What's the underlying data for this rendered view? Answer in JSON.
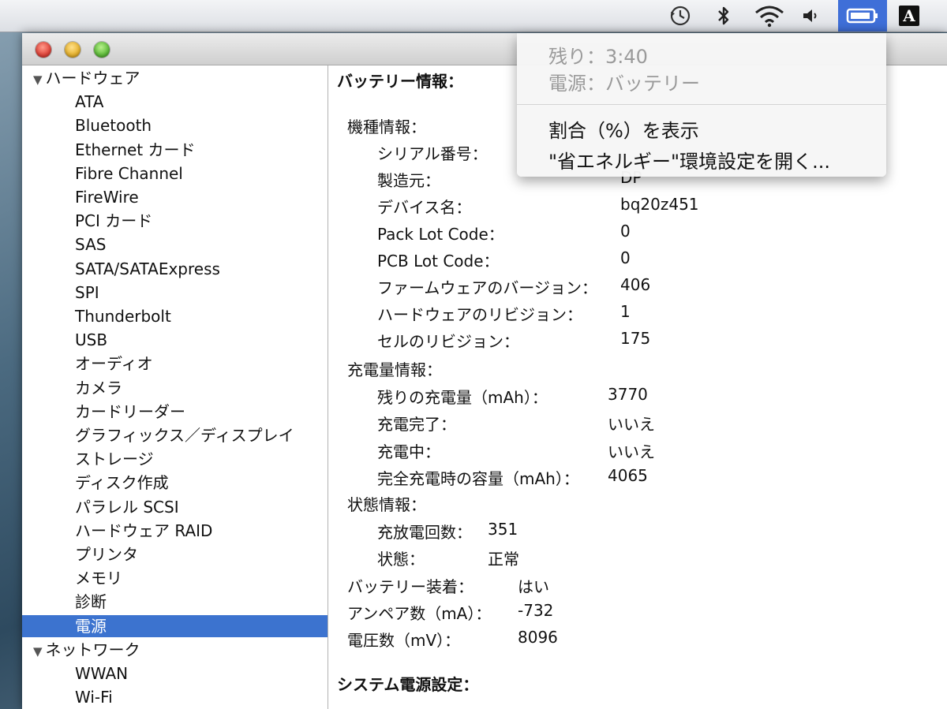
{
  "menubar": {
    "icons": [
      "time-machine-icon",
      "bluetooth-icon",
      "wifi-icon",
      "volume-icon",
      "battery-icon"
    ],
    "input_label": "A"
  },
  "sidebar": {
    "hardware_group": "ハードウェア",
    "hardware_items": [
      "ATA",
      "Bluetooth",
      "Ethernet カード",
      "Fibre Channel",
      "FireWire",
      "PCI カード",
      "SAS",
      "SATA/SATAExpress",
      "SPI",
      "Thunderbolt",
      "USB",
      "オーディオ",
      "カメラ",
      "カードリーダー",
      "グラフィックス／ディスプレイ",
      "ストレージ",
      "ディスク作成",
      "パラレル SCSI",
      "ハードウェア RAID",
      "プリンタ",
      "メモリ",
      "診断",
      "電源"
    ],
    "selected": "電源",
    "network_group": "ネットワーク",
    "network_items": [
      "WWAN",
      "Wi-Fi"
    ]
  },
  "detail": {
    "title": "バッテリー情報：",
    "model_header": "機種情報：",
    "model_rows": [
      {
        "label": "シリアル番号：",
        "value": ""
      },
      {
        "label": "製造元：",
        "value": "DP"
      },
      {
        "label": "デバイス名：",
        "value": "bq20z451"
      },
      {
        "label": "Pack Lot Code：",
        "value": "0"
      },
      {
        "label": "PCB Lot Code：",
        "value": "0"
      },
      {
        "label": "ファームウェアのバージョン：",
        "value": "406"
      },
      {
        "label": "ハードウェアのリビジョン：",
        "value": "1"
      },
      {
        "label": "セルのリビジョン：",
        "value": "175"
      }
    ],
    "charge_header": "充電量情報：",
    "charge_rows": [
      {
        "label": "残りの充電量（mAh）：",
        "value": "3770"
      },
      {
        "label": "充電完了：",
        "value": "いいえ"
      },
      {
        "label": "充電中：",
        "value": "いいえ"
      },
      {
        "label": "完全充電時の容量（mAh）：",
        "value": "4065"
      }
    ],
    "status_header": "状態情報：",
    "status_rows": [
      {
        "label": "充放電回数：",
        "value": "351"
      },
      {
        "label": "状態：",
        "value": "正常"
      }
    ],
    "top_rows": [
      {
        "label": "バッテリー装着：",
        "value": "はい"
      },
      {
        "label": "アンペア数（mA）：",
        "value": "-732"
      },
      {
        "label": "電圧数（mV）：",
        "value": "8096"
      }
    ],
    "system_header": "システム電源設定："
  },
  "battery_menu": {
    "remaining": "残り：3:40",
    "source": "電源：バッテリー",
    "show_percent": "割合（%）を表示",
    "open_prefs": "\"省エネルギー\"環境設定を開く..."
  }
}
